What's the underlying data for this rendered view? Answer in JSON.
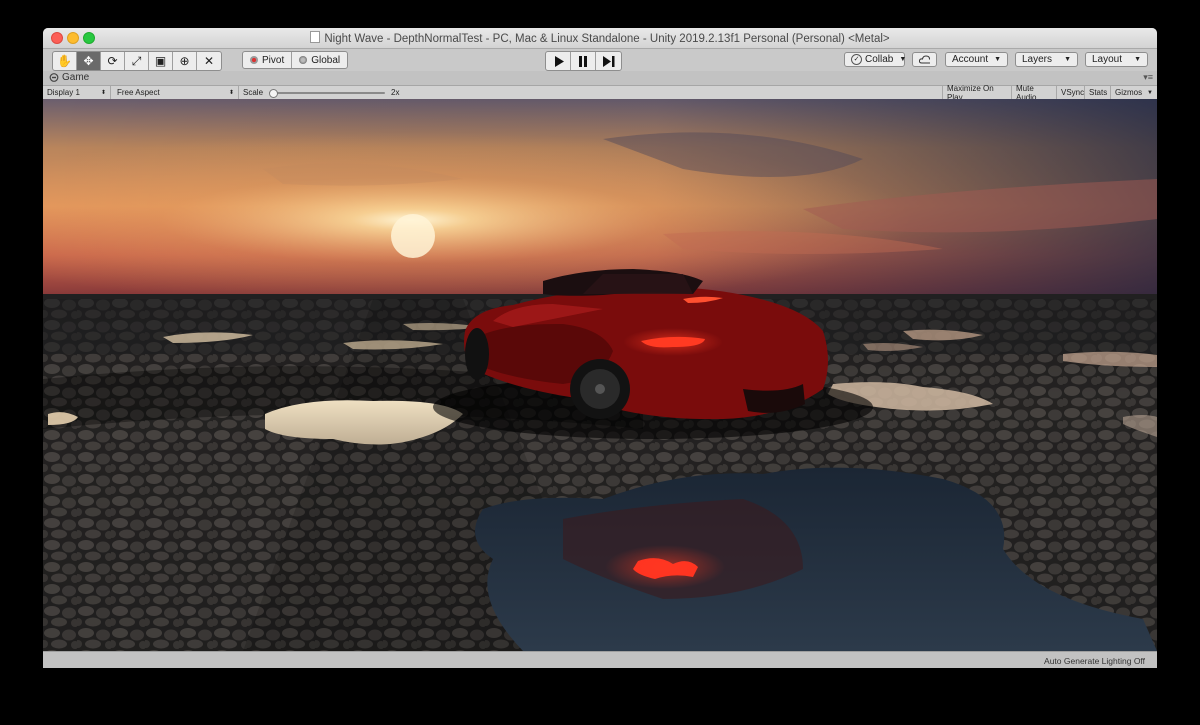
{
  "window": {
    "title": "Night Wave - DepthNormalTest - PC, Mac & Linux Standalone - Unity 2019.2.13f1 Personal (Personal) <Metal>"
  },
  "toolbar": {
    "tools": [
      {
        "name": "hand-tool",
        "glyph": "✋"
      },
      {
        "name": "move-tool",
        "glyph": "✥"
      },
      {
        "name": "rotate-tool",
        "glyph": "⟳"
      },
      {
        "name": "scale-tool",
        "glyph": "⤢"
      },
      {
        "name": "rect-tool",
        "glyph": "▣"
      },
      {
        "name": "transform-tool",
        "glyph": "⊕"
      },
      {
        "name": "custom-tool",
        "glyph": "✕"
      }
    ],
    "active_tool_index": 1,
    "pivot_label": "Pivot",
    "global_label": "Global",
    "collab_label": "Collab",
    "account_label": "Account",
    "layers_label": "Layers",
    "layout_label": "Layout"
  },
  "panel": {
    "tab_label": "Game"
  },
  "gamebar": {
    "display": "Display 1",
    "aspect": "Free Aspect",
    "scale_label": "Scale",
    "scale_value": "2x",
    "maximize": "Maximize On Play",
    "mute": "Mute Audio",
    "vsync": "VSync",
    "stats": "Stats",
    "gizmos": "Gizmos"
  },
  "status": {
    "lighting": "Auto Generate Lighting Off"
  },
  "colors": {
    "taillight": "#ff2a1a",
    "car_body": "#7a0c0c",
    "sun": "#ffe9b8"
  }
}
